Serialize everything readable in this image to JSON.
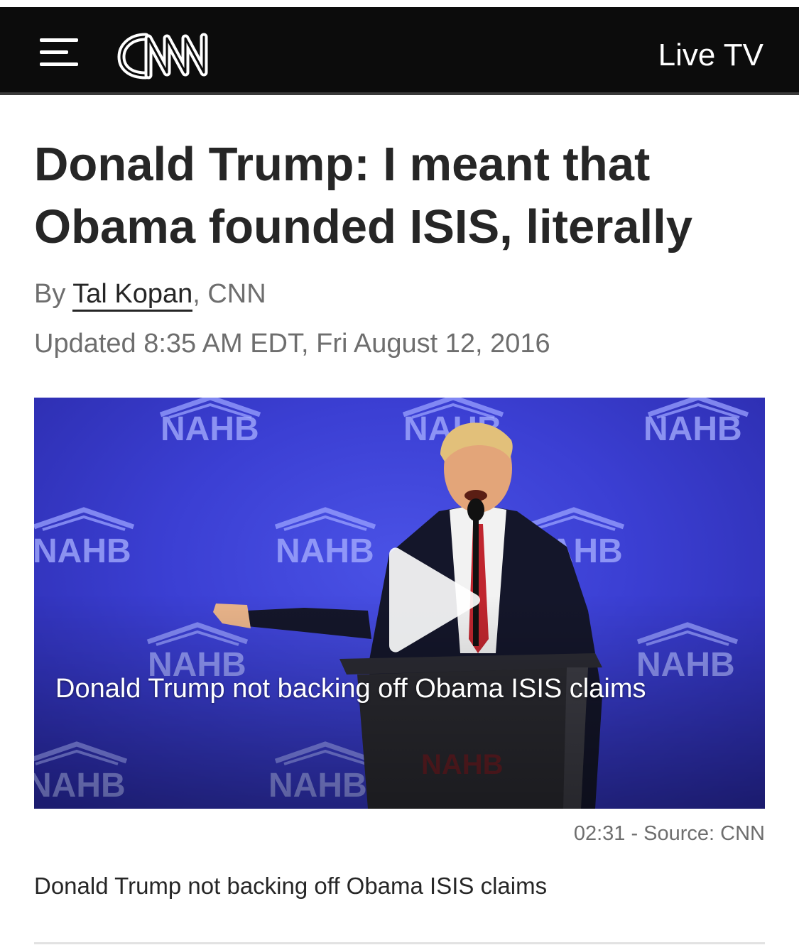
{
  "header": {
    "brand": "CNN",
    "live_tv_label": "Live TV"
  },
  "article": {
    "headline": "Donald Trump: I meant that Obama founded ISIS, literally",
    "byline_prefix": "By",
    "author": "Tal Kopan",
    "byline_suffix": ", CNN",
    "updated": "Updated 8:35 AM EDT, Fri August 12, 2016"
  },
  "video": {
    "overlay_title": "Donald Trump not backing off Obama ISIS claims",
    "backdrop_logo_text": "NAHB",
    "duration": "02:31",
    "source_separator": " - ",
    "source": "Source: CNN",
    "description": "Donald Trump not backing off Obama ISIS claims"
  },
  "colors": {
    "navbar": "#0c0c0c",
    "headline": "#262626",
    "meta_gray": "#6e6e6e",
    "video_backdrop": "#3b3fd3"
  },
  "icons": {
    "menu": "hamburger-menu-icon",
    "play": "play-icon"
  }
}
